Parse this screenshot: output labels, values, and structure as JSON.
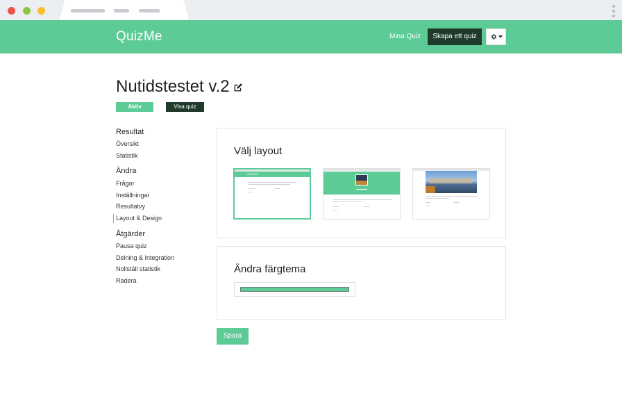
{
  "header": {
    "brand": "QuizMe",
    "nav_my_quiz": "Mina Quiz",
    "create_quiz": "Skapa ett quiz",
    "settings_icon": "gear-icon",
    "colors": {
      "brand_green": "#5ccb95",
      "dark_green": "#1f3a2b"
    }
  },
  "page": {
    "title": "Nutidstestet v.2",
    "edit_icon": "edit-icon",
    "status_button": "Aktiv",
    "show_quiz_button": "Visa quiz"
  },
  "sidebar": {
    "sections": [
      {
        "heading": "Resultat",
        "items": [
          "Översikt",
          "Statistik"
        ]
      },
      {
        "heading": "Ändra",
        "items": [
          "Frågor",
          "Inställningar",
          "Resultatvy",
          "Layout & Design"
        ]
      },
      {
        "heading": "Åtgärder",
        "items": [
          "Pausa quiz",
          "Delning & Integration",
          "Nollställ statistik",
          "Radera"
        ]
      }
    ],
    "active_item": "Layout & Design"
  },
  "layout_panel": {
    "title": "Välj layout",
    "selected_index": 0
  },
  "color_panel": {
    "title": "Ändra färgtema",
    "current_color": "#5ccb95"
  },
  "actions": {
    "save": "Spara"
  }
}
